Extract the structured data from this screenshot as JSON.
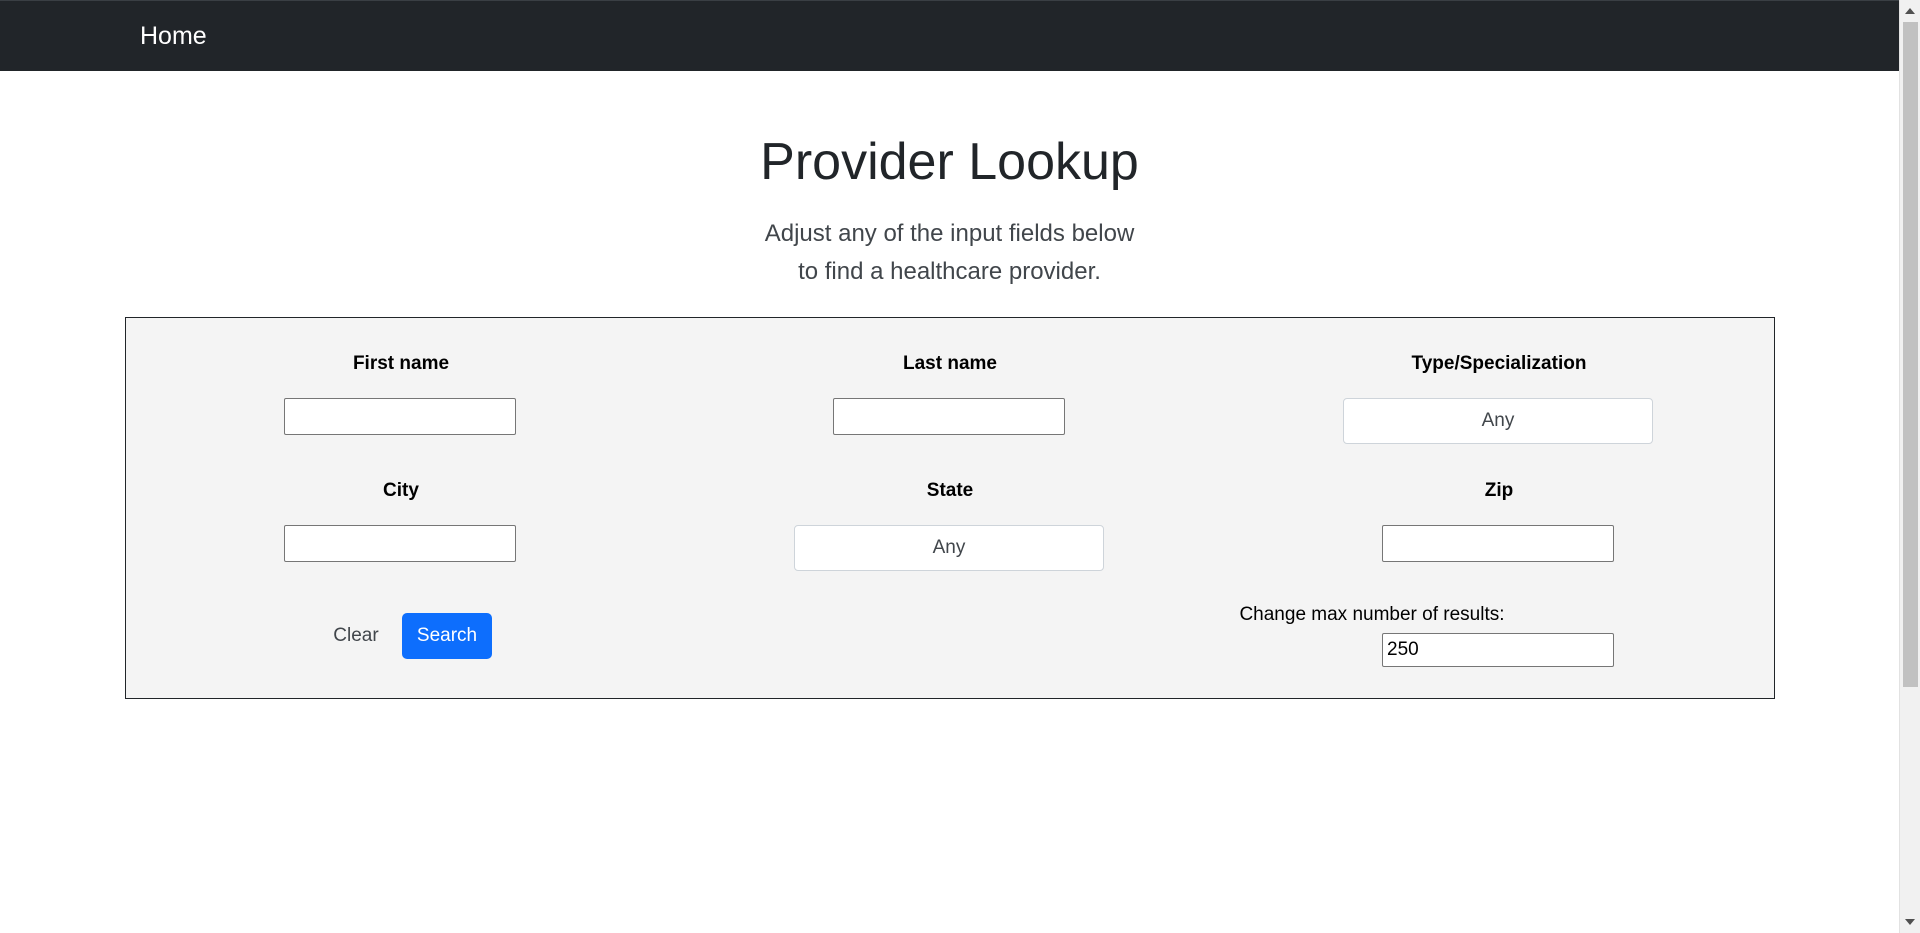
{
  "navbar": {
    "brand": "Home"
  },
  "header": {
    "title": "Provider Lookup",
    "lead_line1": "Adjust any of the input fields below",
    "lead_line2": "to find a healthcare provider."
  },
  "form": {
    "first_name_label": "First name",
    "first_name_value": "",
    "last_name_label": "Last name",
    "last_name_value": "",
    "type_label": "Type/Specialization",
    "type_value": "Any",
    "city_label": "City",
    "city_value": "",
    "state_label": "State",
    "state_value": "Any",
    "zip_label": "Zip",
    "zip_value": "",
    "clear_label": "Clear",
    "search_label": "Search",
    "max_results_label": "Change max number of results:",
    "max_results_value": "250"
  },
  "colors": {
    "navbar_bg": "#212529",
    "primary": "#0d6efd",
    "panel_bg": "#f4f4f4"
  }
}
